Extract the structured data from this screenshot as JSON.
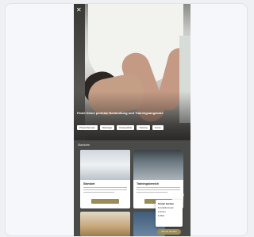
{
  "hero": {
    "caption": "Finde Deine perfekte Behandlung und Trainingsangebote"
  },
  "chips": [
    "Physiotherapie",
    "Massage",
    "Osteopathie",
    "Training",
    "Kurse"
  ],
  "section": {
    "title": "Standorte"
  },
  "tiles": [
    {
      "title": "Standort"
    },
    {
      "title": "Trainingsbereich"
    }
  ],
  "popup": {
    "items": [
      "Termin buchen",
      "Kontaktformular",
      "Anrufen",
      "E-Mail"
    ]
  },
  "fab": {
    "label": "Termin buchen"
  },
  "icons": {
    "top": "close-icon",
    "close": "close-icon"
  },
  "colors": {
    "accent": "#9b8b55",
    "section_bg": "#4a4a48"
  }
}
